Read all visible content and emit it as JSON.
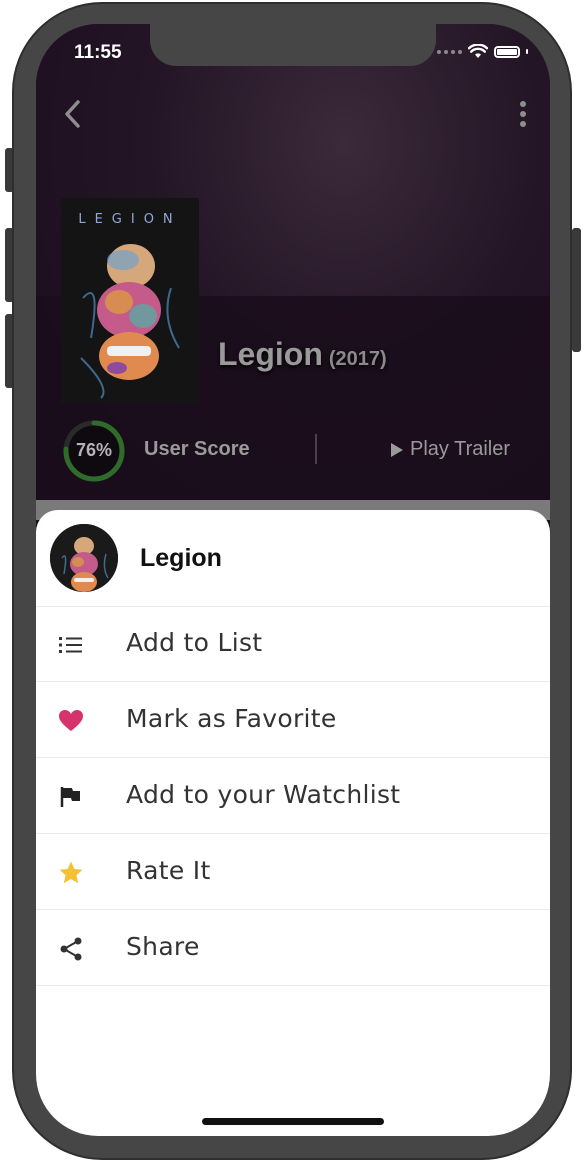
{
  "status_bar": {
    "time": "11:55"
  },
  "header": {
    "poster_title": "LEGION",
    "title": "Legion",
    "year": "(2017)",
    "user_score": {
      "percent": "76%",
      "value": 0.76,
      "label": "User Score"
    },
    "trailer_label": "Play Trailer"
  },
  "sheet": {
    "title": "Legion",
    "items": [
      {
        "label": "Add to List",
        "icon": "list-icon"
      },
      {
        "label": "Mark as Favorite",
        "icon": "heart-icon"
      },
      {
        "label": "Add to your Watchlist",
        "icon": "flag-icon"
      },
      {
        "label": "Rate It",
        "icon": "star-icon"
      },
      {
        "label": "Share",
        "icon": "share-icon"
      }
    ]
  },
  "colors": {
    "heart": "#d6336c",
    "star": "#f5c033",
    "score_ring": "#2f6b2a",
    "hero_bg": "#1d0f1f"
  }
}
